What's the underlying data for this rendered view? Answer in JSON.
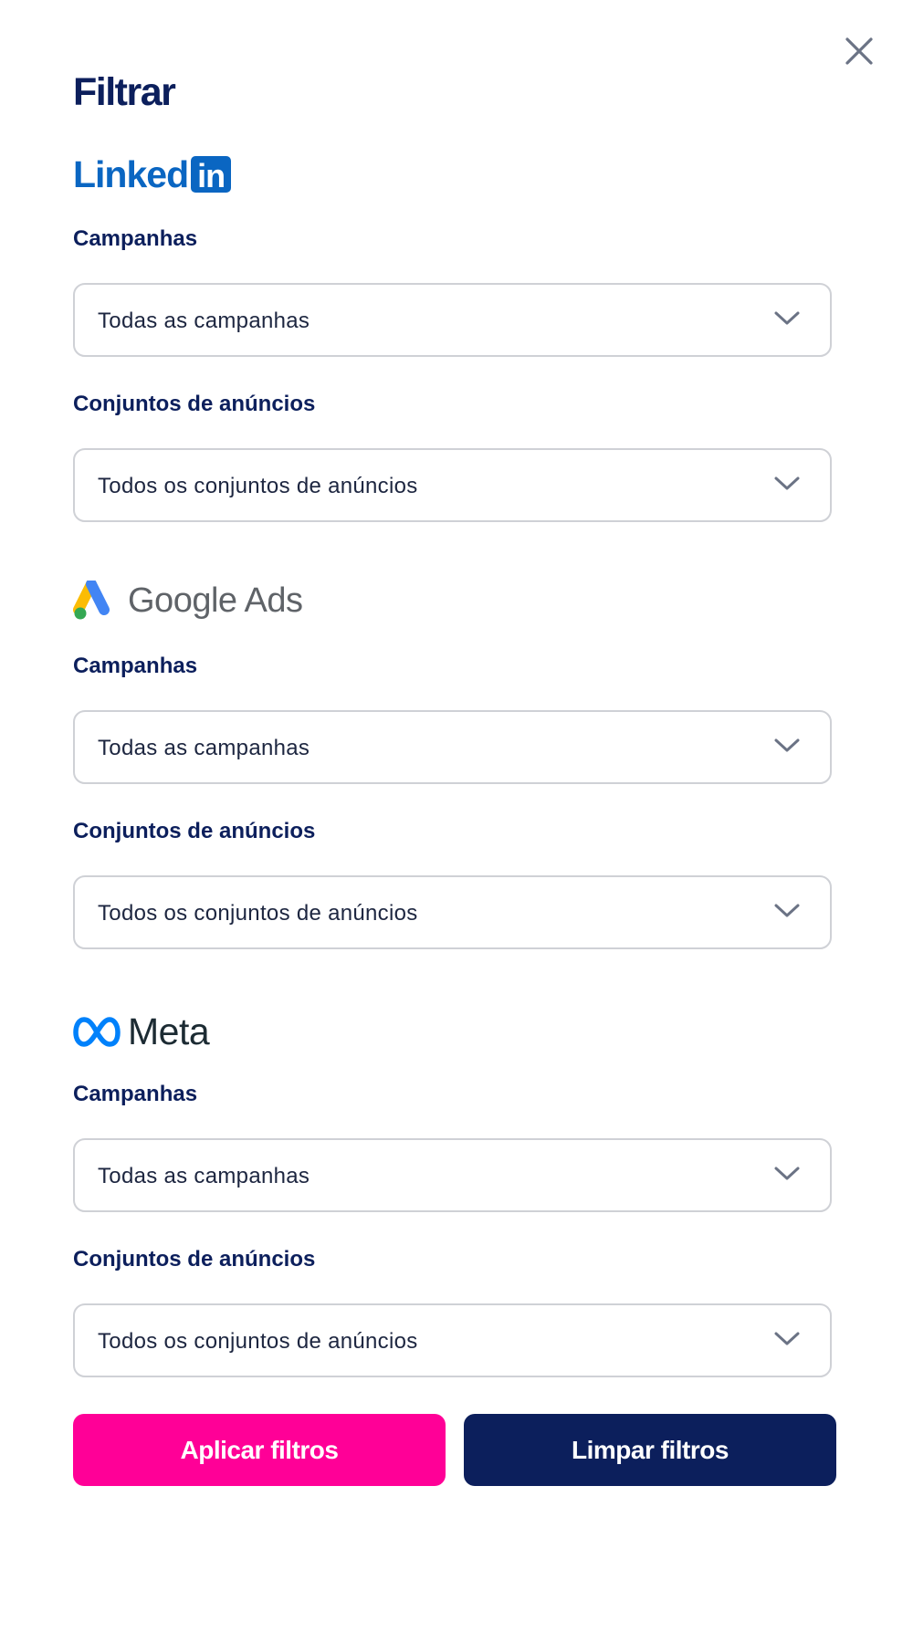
{
  "header": {
    "title": "Filtrar"
  },
  "sections": {
    "linkedin": {
      "brand": {
        "text": "Linked",
        "box": "in"
      },
      "campaigns_label": "Campanhas",
      "campaigns_value": "Todas as campanhas",
      "adsets_label": "Conjuntos de anúncios",
      "adsets_value": "Todos os conjuntos de anúncios"
    },
    "google": {
      "brand": {
        "text": "Google Ads"
      },
      "campaigns_label": "Campanhas",
      "campaigns_value": "Todas as campanhas",
      "adsets_label": "Conjuntos de anúncios",
      "adsets_value": "Todos os conjuntos de anúncios"
    },
    "meta": {
      "brand": {
        "text": "Meta"
      },
      "campaigns_label": "Campanhas",
      "campaigns_value": "Todas as campanhas",
      "adsets_label": "Conjuntos de anúncios",
      "adsets_value": "Todos os conjuntos de anúncios"
    }
  },
  "actions": {
    "apply_label": "Aplicar filtros",
    "clear_label": "Limpar filtros"
  },
  "icons": {
    "close": "close-icon",
    "chevron": "chevron-down-icon"
  },
  "colors": {
    "title": "#0c1f5c",
    "apply_button": "#ff0097",
    "clear_button": "#0c1f5c",
    "linkedin_blue": "#0a66c2",
    "meta_blue": "#0081fb"
  }
}
